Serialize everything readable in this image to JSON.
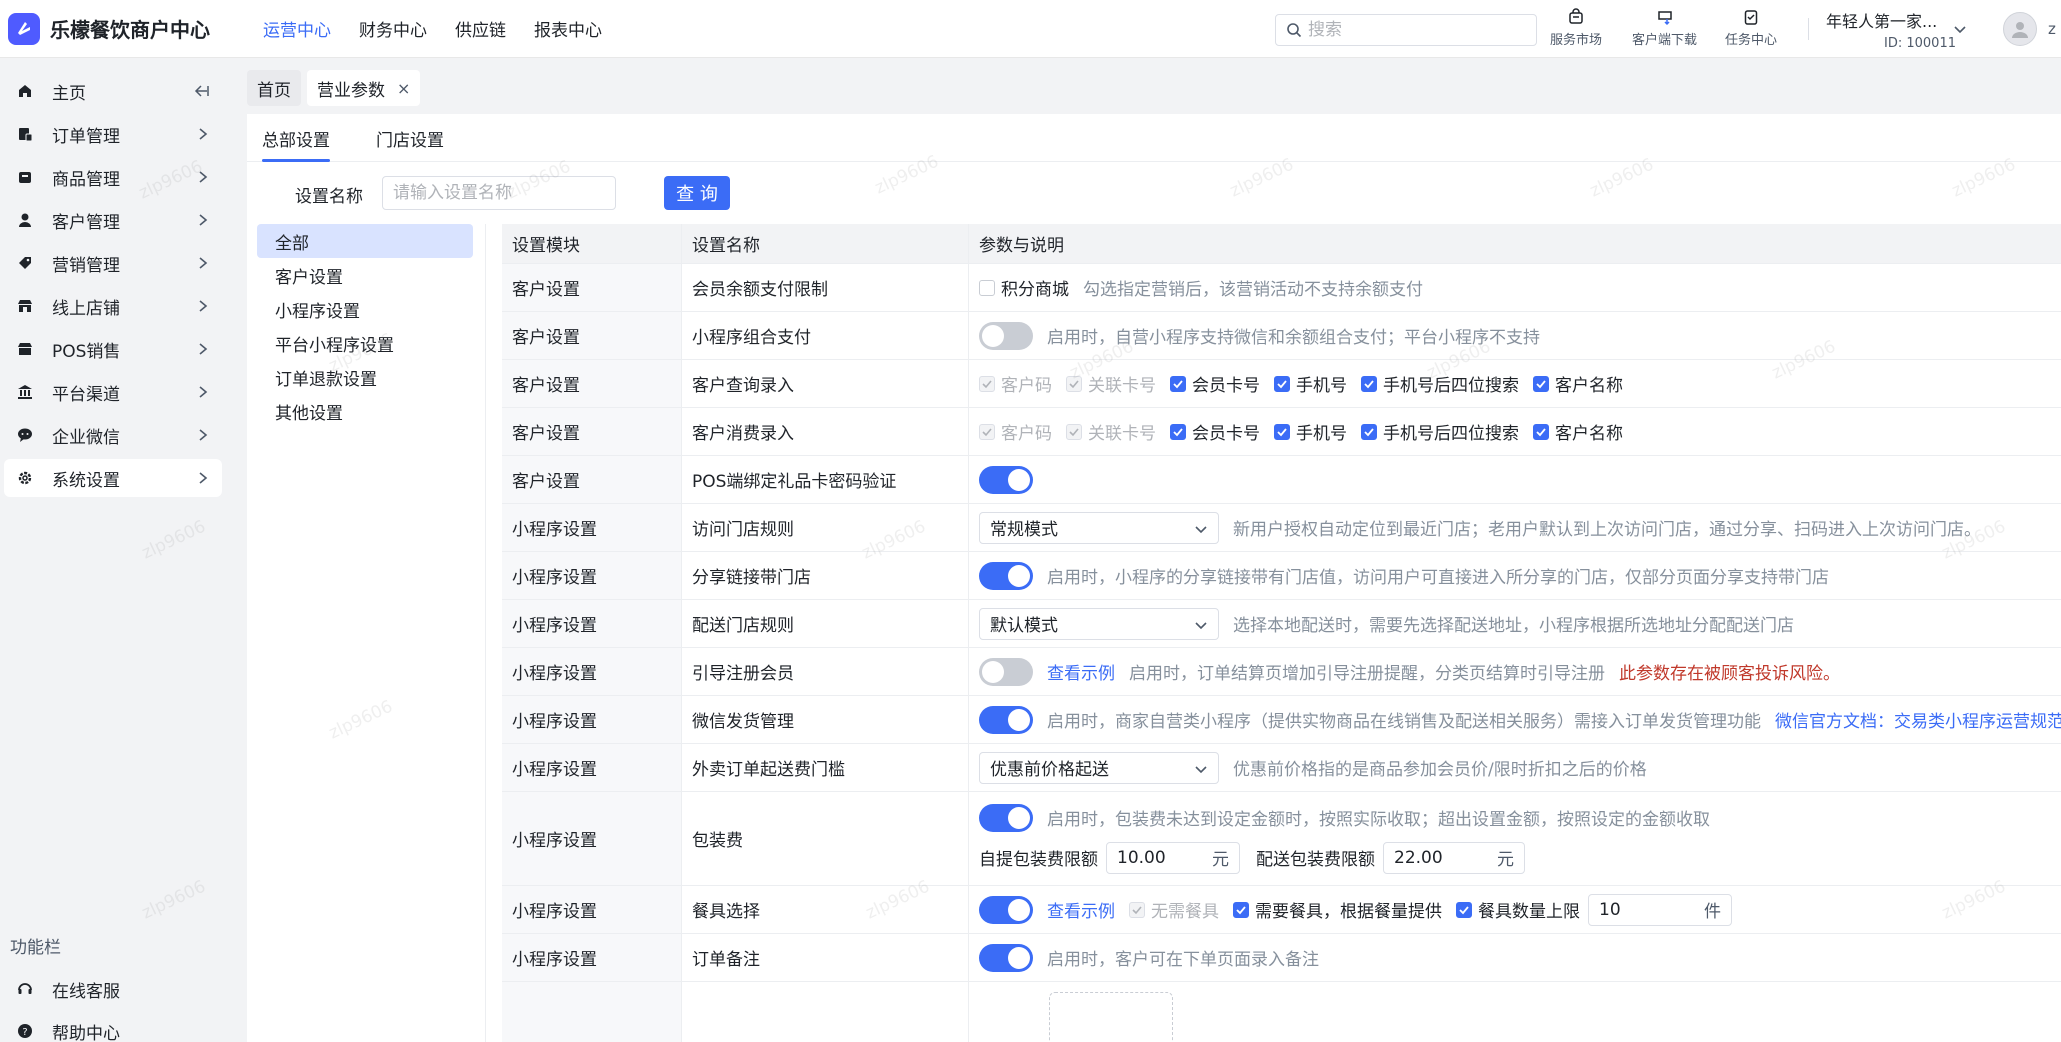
{
  "app": {
    "title": "乐檬餐饮商户中心"
  },
  "topnav": [
    {
      "label": "运营中心",
      "active": true
    },
    {
      "label": "财务中心",
      "active": false
    },
    {
      "label": "供应链",
      "active": false
    },
    {
      "label": "报表中心",
      "active": false
    }
  ],
  "search": {
    "placeholder": "搜索"
  },
  "tools": {
    "service_market": "服务市场",
    "client_download": "客户端下载",
    "task_center": "任务中心"
  },
  "account": {
    "name": "年轻人第一家...",
    "id": "ID: 100011",
    "avatar_letter": "z"
  },
  "sidebar": {
    "home": "主页",
    "items": [
      {
        "label": "订单管理",
        "icon": "order-icon"
      },
      {
        "label": "商品管理",
        "icon": "goods-icon"
      },
      {
        "label": "客户管理",
        "icon": "user-icon"
      },
      {
        "label": "营销管理",
        "icon": "tag-icon"
      },
      {
        "label": "线上店铺",
        "icon": "store-icon"
      },
      {
        "label": "POS销售",
        "icon": "pos-icon"
      },
      {
        "label": "平台渠道",
        "icon": "bank-icon"
      },
      {
        "label": "企业微信",
        "icon": "wechat-icon"
      },
      {
        "label": "系统设置",
        "icon": "gear-icon"
      }
    ],
    "section_title": "功能栏",
    "footer": [
      {
        "label": "在线客服",
        "icon": "headset-icon"
      },
      {
        "label": "帮助中心",
        "icon": "help-icon"
      }
    ]
  },
  "pagetabs": [
    {
      "label": "首页",
      "closable": false
    },
    {
      "label": "营业参数",
      "closable": true
    }
  ],
  "subtabs": [
    {
      "label": "总部设置",
      "active": true
    },
    {
      "label": "门店设置",
      "active": false
    }
  ],
  "filter": {
    "label": "设置名称",
    "placeholder": "请输入设置名称",
    "button": "查 询"
  },
  "categories": [
    "全部",
    "客户设置",
    "小程序设置",
    "平台小程序设置",
    "订单退款设置",
    "其他设置"
  ],
  "table": {
    "headers": [
      "设置模块",
      "设置名称",
      "参数与说明"
    ],
    "rows": [
      {
        "module": "客户设置",
        "name": "会员余额支付限制",
        "checkbox": "积分商城",
        "desc": "勾选指定营销后，该营销活动不支持余额支付"
      },
      {
        "module": "客户设置",
        "name": "小程序组合支付",
        "switch": "off",
        "desc": "启用时，自营小程序支持微信和余额组合支付；平台小程序不支持"
      },
      {
        "module": "客户设置",
        "name": "客户查询录入",
        "options": [
          {
            "label": "客户码",
            "state": "disabled"
          },
          {
            "label": "关联卡号",
            "state": "disabled"
          },
          {
            "label": "会员卡号",
            "state": "on"
          },
          {
            "label": "手机号",
            "state": "on"
          },
          {
            "label": "手机号后四位搜索",
            "state": "on"
          },
          {
            "label": "客户名称",
            "state": "on"
          }
        ]
      },
      {
        "module": "客户设置",
        "name": "客户消费录入",
        "options": [
          {
            "label": "客户码",
            "state": "disabled"
          },
          {
            "label": "关联卡号",
            "state": "disabled"
          },
          {
            "label": "会员卡号",
            "state": "on"
          },
          {
            "label": "手机号",
            "state": "on"
          },
          {
            "label": "手机号后四位搜索",
            "state": "on"
          },
          {
            "label": "客户名称",
            "state": "on"
          }
        ]
      },
      {
        "module": "客户设置",
        "name": "POS端绑定礼品卡密码验证",
        "switch": "on"
      },
      {
        "module": "小程序设置",
        "name": "访问门店规则",
        "select": "常规模式",
        "desc": "新用户授权自动定位到最近门店；老用户默认到上次访问门店，通过分享、扫码进入上次访问门店。"
      },
      {
        "module": "小程序设置",
        "name": "分享链接带门店",
        "switch": "on",
        "desc": "启用时，小程序的分享链接带有门店值，访问用户可直接进入所分享的门店，仅部分页面分享支持带门店"
      },
      {
        "module": "小程序设置",
        "name": "配送门店规则",
        "select": "默认模式",
        "desc": "选择本地配送时，需要先选择配送地址，小程序根据所选地址分配配送门店"
      },
      {
        "module": "小程序设置",
        "name": "引导注册会员",
        "switch": "off",
        "link": "查看示例",
        "desc": "启用时，订单结算页增加引导注册提醒，分类页结算时引导注册",
        "warn": "此参数存在被顾客投诉风险。"
      },
      {
        "module": "小程序设置",
        "name": "微信发货管理",
        "switch": "on",
        "desc": "启用时，商家自营类小程序（提供实物商品在线销售及配送相关服务）需接入订单发货管理功能",
        "link": "微信官方文档：交易类小程序运营规范"
      },
      {
        "module": "小程序设置",
        "name": "外卖订单起送费门槛",
        "select": "优惠前价格起送",
        "desc": "优惠前价格指的是商品参加会员价/限时折扣之后的价格"
      },
      {
        "module": "小程序设置",
        "name": "包装费",
        "switch": "on",
        "desc": "启用时，包装费未达到设定金额时，按照实际收取；超出设置金额，按照设定的金额收取",
        "fields": [
          {
            "label": "自提包装费限额",
            "value": "10.00",
            "unit": "元"
          },
          {
            "label": "配送包装费限额",
            "value": "22.00",
            "unit": "元"
          }
        ]
      },
      {
        "module": "小程序设置",
        "name": "餐具选择",
        "switch": "on",
        "link": "查看示例",
        "options": [
          {
            "label": "无需餐具",
            "state": "disabled"
          },
          {
            "label": "需要餐具，根据餐量提供",
            "state": "on"
          },
          {
            "label": "餐具数量上限",
            "state": "on"
          }
        ],
        "limit": {
          "value": "10",
          "unit": "件"
        }
      },
      {
        "module": "小程序设置",
        "name": "订单备注",
        "switch": "on",
        "desc": "启用时，客户可在下单页面录入备注"
      }
    ]
  },
  "colors": {
    "primary": "#3b6cf6",
    "warn": "#c0392b",
    "muted": "#86909c"
  },
  "watermark": "zlp9606"
}
